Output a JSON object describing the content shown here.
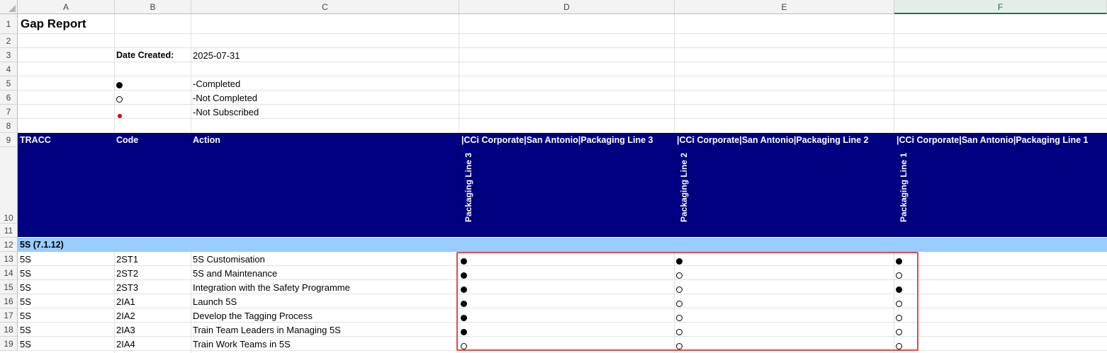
{
  "columns": [
    "A",
    "B",
    "C",
    "D",
    "E",
    "F"
  ],
  "row_numbers": [
    "1",
    "2",
    "3",
    "4",
    "5",
    "6",
    "7",
    "8",
    "9",
    "10",
    "11",
    "12",
    "13",
    "14",
    "15",
    "16",
    "17",
    "18",
    "19"
  ],
  "report": {
    "title": "Gap Report",
    "date_label": "Date Created:",
    "date_value": "2025-07-31"
  },
  "legend": [
    {
      "symbol": "filled",
      "label": "-Completed"
    },
    {
      "symbol": "open",
      "label": "-Not Completed"
    },
    {
      "symbol": "red",
      "label": "-Not Subscribed"
    }
  ],
  "table_header": {
    "tracc": "TRACC",
    "code": "Code",
    "action": "Action",
    "sites": [
      {
        "path": "|CCi Corporate|San Antonio|Packaging Line 3",
        "short": "Packaging Line 3"
      },
      {
        "path": "|CCi Corporate|San Antonio|Packaging Line 2",
        "short": "Packaging Line 2"
      },
      {
        "path": "|CCi Corporate|San Antonio|Packaging Line 1",
        "short": "Packaging Line 1"
      }
    ]
  },
  "category": "5S (7.1.12)",
  "rows": [
    {
      "tracc": "5S",
      "code": "2ST1",
      "action": "5S Customisation",
      "status": [
        "filled",
        "filled",
        "filled"
      ]
    },
    {
      "tracc": "5S",
      "code": "2ST2",
      "action": "5S and Maintenance",
      "status": [
        "filled",
        "open",
        "open"
      ]
    },
    {
      "tracc": "5S",
      "code": "2ST3",
      "action": "Integration with the Safety Programme",
      "status": [
        "filled",
        "open",
        "filled"
      ]
    },
    {
      "tracc": "5S",
      "code": "2IA1",
      "action": "Launch 5S",
      "status": [
        "filled",
        "open",
        "open"
      ]
    },
    {
      "tracc": "5S",
      "code": "2IA2",
      "action": "Develop the Tagging Process",
      "status": [
        "filled",
        "open",
        "open"
      ]
    },
    {
      "tracc": "5S",
      "code": "2IA3",
      "action": "Train Team Leaders in Managing 5S",
      "status": [
        "filled",
        "open",
        "open"
      ]
    },
    {
      "tracc": "5S",
      "code": "2IA4",
      "action": "Train Work Teams in 5S",
      "status": [
        "open",
        "open",
        "open"
      ]
    }
  ]
}
